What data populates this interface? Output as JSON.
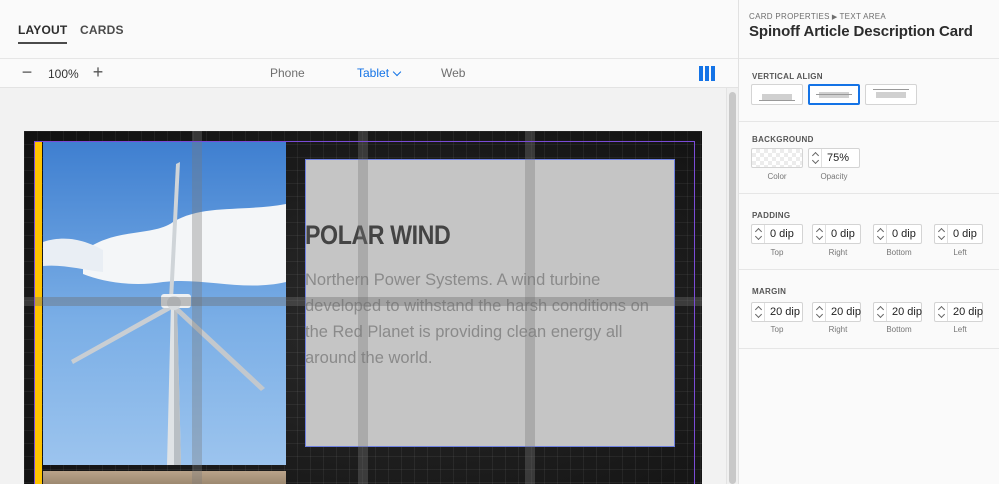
{
  "tabs": [
    {
      "label": "LAYOUT",
      "active": true
    },
    {
      "label": "CARDS",
      "active": false
    }
  ],
  "toolbar": {
    "zoom": "100%",
    "devices": {
      "phone": "Phone",
      "tablet": "Tablet",
      "web": "Web"
    },
    "selected_device": "Tablet"
  },
  "card": {
    "title": "POLAR WIND",
    "description": "Northern Power Systems. A wind turbine developed to withstand the harsh conditions on the Red Planet is providing clean energy all around the world.",
    "image": "wind-turbine-photo",
    "accent_color": "#ffc400"
  },
  "panel": {
    "breadcrumb": [
      "CARD PROPERTIES",
      "TEXT AREA"
    ],
    "title": "Spinoff Article Description Card",
    "vertical_align": {
      "label": "VERTICAL ALIGN",
      "selected": "middle",
      "options": [
        "bottom",
        "middle",
        "top"
      ]
    },
    "background": {
      "label": "BACKGROUND",
      "opacity": "75%",
      "color_caption": "Color",
      "opacity_caption": "Opacity"
    },
    "padding": {
      "label": "PADDING",
      "values": [
        "0 dip",
        "0 dip",
        "0 dip",
        "0 dip"
      ],
      "captions": [
        "Top",
        "Right",
        "Bottom",
        "Left"
      ]
    },
    "margin": {
      "label": "MARGIN",
      "values": [
        "20 dip",
        "20 dip",
        "20 dip",
        "20 dip"
      ],
      "captions": [
        "Top",
        "Right",
        "Bottom",
        "Left"
      ]
    }
  },
  "colors": {
    "accent_blue": "#1473e6",
    "selection_outline": "#6d7fe0"
  }
}
